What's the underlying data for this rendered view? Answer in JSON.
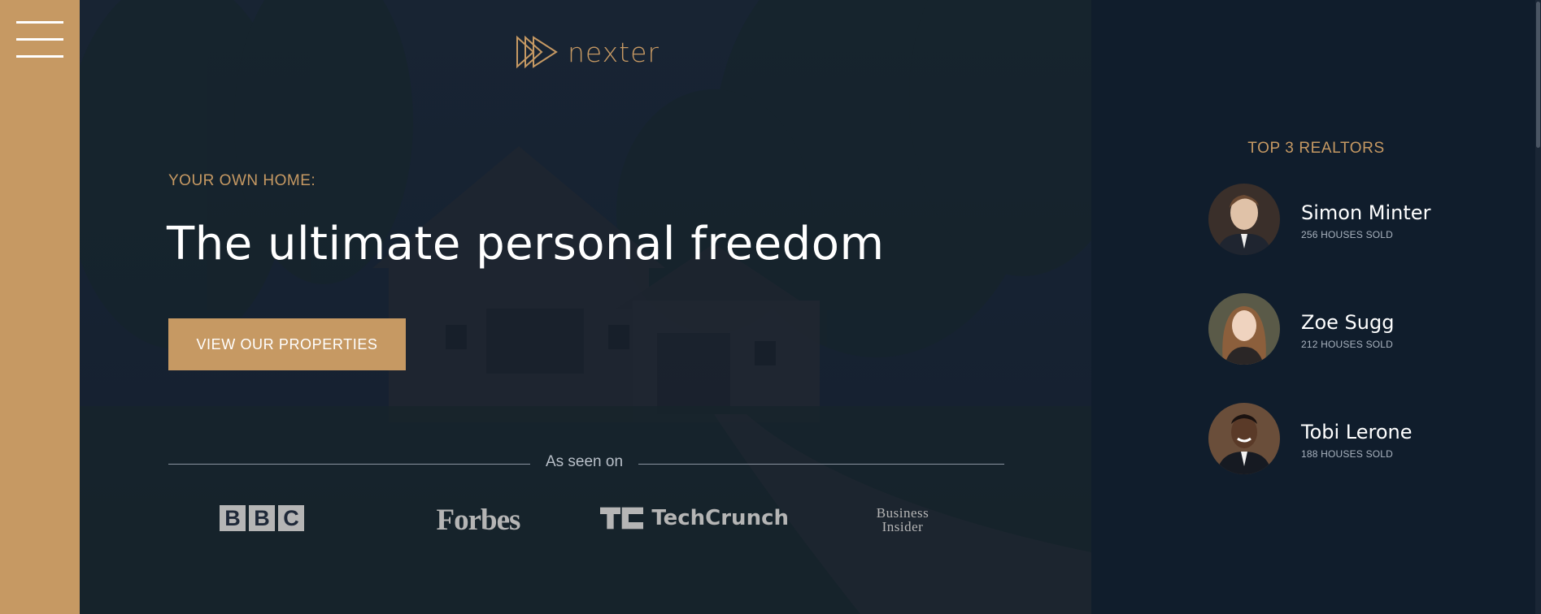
{
  "sidebar": {
    "menu_icon": "hamburger-menu-icon",
    "bg_color": "#c69963"
  },
  "header": {
    "logo_icon": "triple-play-logo-icon",
    "logo_text": "nexter"
  },
  "hero": {
    "pretitle": "YOUR OWN HOME:",
    "headline": "The ultimate personal freedom",
    "cta_label": "VIEW OUR PROPERTIES",
    "seen_on_label": "As seen on",
    "press": [
      {
        "name": "BBC",
        "letters": [
          "B",
          "B",
          "C"
        ]
      },
      {
        "name": "Forbes"
      },
      {
        "name": "TechCrunch",
        "glyph": "TC"
      },
      {
        "name": "Business Insider",
        "line1": "Business",
        "line2": "Insider"
      }
    ]
  },
  "realtors": {
    "title": "TOP 3 REALTORS",
    "items": [
      {
        "name": "Simon Minter",
        "sold": "256 HOUSES SOLD",
        "avatar": "avatar-man-suit"
      },
      {
        "name": "Zoe Sugg",
        "sold": "212 HOUSES SOLD",
        "avatar": "avatar-woman"
      },
      {
        "name": "Tobi Lerone",
        "sold": "188 HOUSES SOLD",
        "avatar": "avatar-man-smiling"
      }
    ]
  },
  "colors": {
    "accent": "#c69963",
    "dark": "#101d2c",
    "text": "#ffffff"
  }
}
